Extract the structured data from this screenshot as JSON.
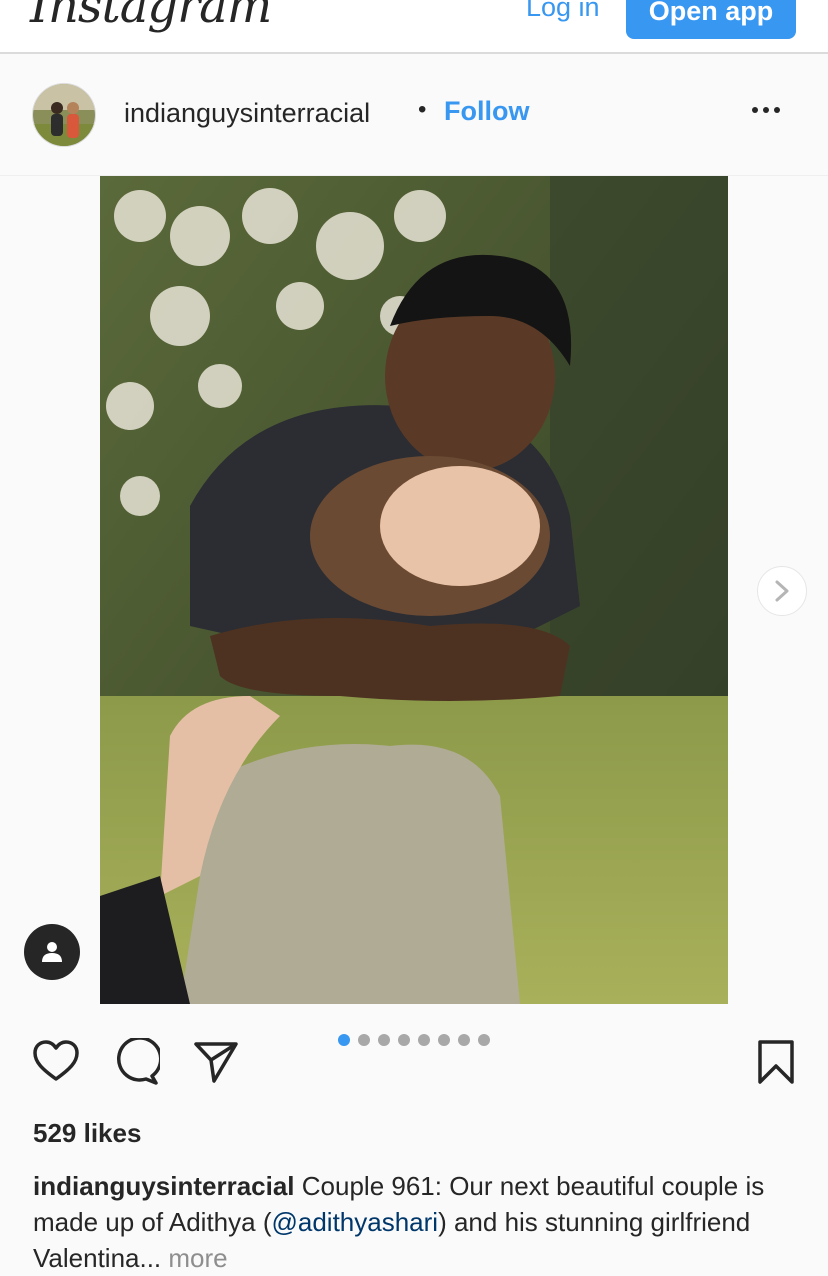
{
  "topbar": {
    "logo_text": "Instagram",
    "login_label": "Log in",
    "open_app_label": "Open app"
  },
  "post": {
    "username": "indianguysinterracial",
    "separator": "•",
    "follow_label": "Follow",
    "more_icon": "more-horizontal-icon",
    "carousel": {
      "count": 8,
      "active_index": 0
    },
    "likes_text": "529 likes",
    "caption": {
      "username": "indianguysinterracial",
      "text_before": " Couple 961: Our next beautiful couple is made up of Adithya (",
      "mention": "@adithyashari",
      "text_after": ") and his stunning girlfriend Valentina...",
      "more_label": " more"
    }
  },
  "colors": {
    "accent": "#3897f0",
    "text": "#262626",
    "muted": "#8e8e8e",
    "mention": "#00376b"
  }
}
